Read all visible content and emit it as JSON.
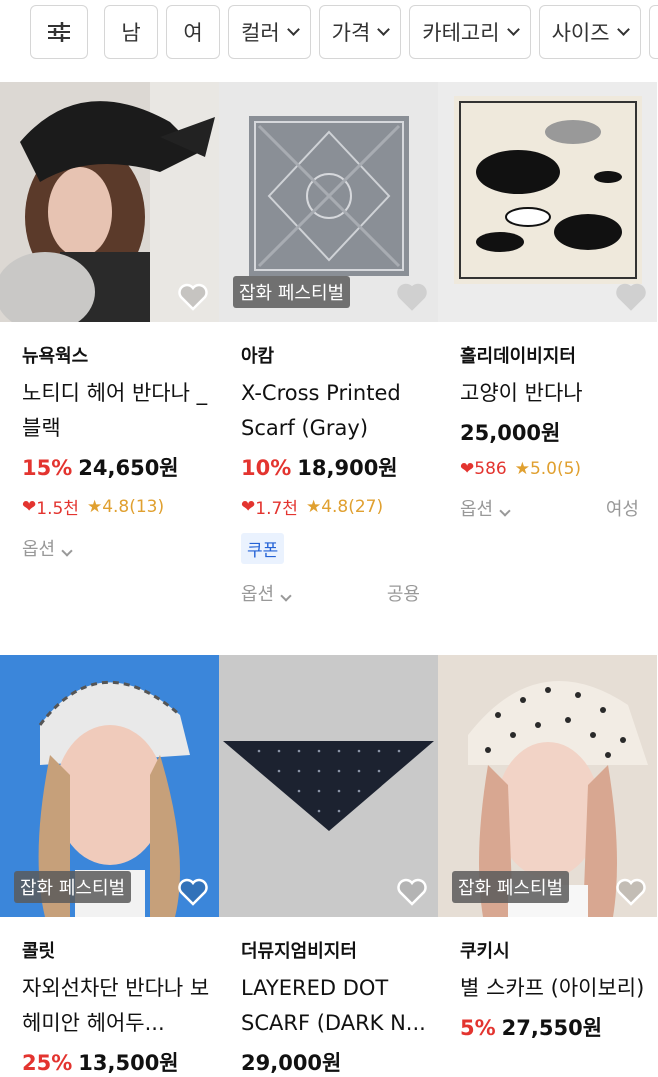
{
  "filters": {
    "icon": "sliders-icon",
    "items": [
      "남",
      "여",
      "컬러",
      "가격",
      "카테고리",
      "사이즈"
    ]
  },
  "products": [
    {
      "brand": "뉴욕웍스",
      "name": "노티디 헤어 반다나 _ 블랙",
      "discount": "15%",
      "price": "24,650원",
      "likes": "1.5천",
      "rating": "4.8(13)",
      "badge": "",
      "coupon": "",
      "option": "옵션",
      "gender": "",
      "heart": "heart-outline-icon"
    },
    {
      "brand": "아캄",
      "name": "X-Cross Printed Scarf (Gray)",
      "discount": "10%",
      "price": "18,900원",
      "likes": "1.7천",
      "rating": "4.8(27)",
      "badge": "잡화 페스티벌",
      "coupon": "쿠폰",
      "option": "옵션",
      "gender": "공용",
      "heart": "heart-outline-icon"
    },
    {
      "brand": "홀리데이비지터",
      "name": "고양이 반다나",
      "discount": "",
      "price": "25,000원",
      "likes": "586",
      "rating": "5.0(5)",
      "badge": "",
      "coupon": "",
      "option": "옵션",
      "gender": "여성",
      "heart": "heart-outline-icon"
    },
    {
      "brand": "콜릿",
      "name": "자외선차단 반다나 보헤미안 헤어두...",
      "discount": "25%",
      "price": "13,500원",
      "likes": "",
      "rating": "",
      "badge": "잡화 페스티벌",
      "coupon": "",
      "option": "",
      "gender": "",
      "heart": "heart-outline-icon"
    },
    {
      "brand": "더뮤지엄비지터",
      "name": "LAYERED DOT SCARF (DARK N...",
      "discount": "",
      "price": "29,000원",
      "likes": "",
      "rating": "",
      "badge": "",
      "coupon": "",
      "option": "",
      "gender": "",
      "heart": "heart-outline-icon"
    },
    {
      "brand": "쿠키시",
      "name": "별 스카프 (아이보리)",
      "discount": "5%",
      "price": "27,550원",
      "likes": "",
      "rating": "",
      "badge": "잡화 페스티벌",
      "coupon": "",
      "option": "",
      "gender": "",
      "heart": "heart-outline-icon"
    }
  ]
}
